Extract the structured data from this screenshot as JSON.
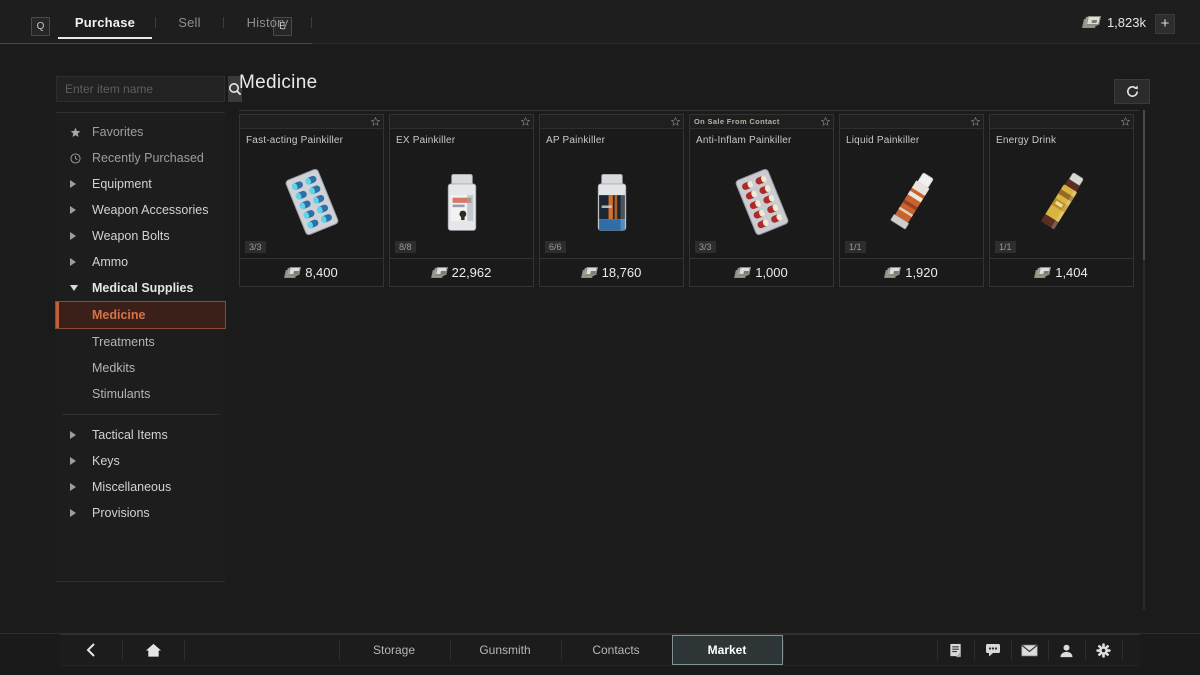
{
  "header": {
    "key_left": "Q",
    "key_right": "E",
    "tabs": [
      {
        "label": "Purchase",
        "active": true
      },
      {
        "label": "Sell",
        "active": false
      },
      {
        "label": "History",
        "active": false
      }
    ],
    "currency_amount": "1,823k",
    "currency_icon": "banknote-stack-icon",
    "add_label": "+"
  },
  "sidebar": {
    "search": {
      "value": "",
      "placeholder": "Enter item name",
      "icon": "search-icon"
    },
    "items": [
      {
        "label": "Favorites",
        "icon": "star-icon",
        "type": "link"
      },
      {
        "label": "Recently Purchased",
        "icon": "clock-icon",
        "type": "link"
      },
      {
        "label": "Equipment",
        "icon": "chevron-right-icon",
        "type": "group"
      },
      {
        "label": "Weapon Accessories",
        "icon": "chevron-right-icon",
        "type": "group"
      },
      {
        "label": "Weapon Bolts",
        "icon": "chevron-right-icon",
        "type": "group"
      },
      {
        "label": "Ammo",
        "icon": "chevron-right-icon",
        "type": "group"
      },
      {
        "label": "Medical Supplies",
        "icon": "chevron-down-icon",
        "type": "group-open"
      },
      {
        "label": "Medicine",
        "icon": "",
        "type": "sub-selected"
      },
      {
        "label": "Treatments",
        "icon": "",
        "type": "sub"
      },
      {
        "label": "Medkits",
        "icon": "",
        "type": "sub"
      },
      {
        "label": "Stimulants",
        "icon": "",
        "type": "sub"
      },
      {
        "label": "Tactical Items",
        "icon": "chevron-right-icon",
        "type": "group"
      },
      {
        "label": "Keys",
        "icon": "chevron-right-icon",
        "type": "group"
      },
      {
        "label": "Miscellaneous",
        "icon": "chevron-right-icon",
        "type": "group"
      },
      {
        "label": "Provisions",
        "icon": "chevron-right-icon",
        "type": "group"
      }
    ]
  },
  "main": {
    "title": "Medicine",
    "refresh_icon": "refresh-icon",
    "items": [
      {
        "banner": "",
        "name": "Fast-acting Painkiller",
        "stock": "3/3",
        "price": "8,400",
        "art": "pill-blister-blue"
      },
      {
        "banner": "",
        "name": "EX Painkiller",
        "stock": "8/8",
        "price": "22,962",
        "art": "pill-bottle-white"
      },
      {
        "banner": "",
        "name": "AP Painkiller",
        "stock": "6/6",
        "price": "18,760",
        "art": "pill-bottle-blue"
      },
      {
        "banner": "On Sale From Contact",
        "name": "Anti-Inflam Painkiller",
        "stock": "3/3",
        "price": "1,000",
        "art": "pill-blister-red"
      },
      {
        "banner": "",
        "name": "Liquid Painkiller",
        "stock": "1/1",
        "price": "1,920",
        "art": "tube-orange"
      },
      {
        "banner": "",
        "name": "Energy Drink",
        "stock": "1/1",
        "price": "1,404",
        "art": "bottle-yellow"
      }
    ]
  },
  "bottombar": {
    "back_icon": "back-arrow-icon",
    "home_icon": "home-icon",
    "tabs": [
      {
        "label": "Storage",
        "active": false
      },
      {
        "label": "Gunsmith",
        "active": false
      },
      {
        "label": "Contacts",
        "active": false
      },
      {
        "label": "Market",
        "active": true
      }
    ],
    "icons": [
      "notes-icon",
      "chat-icon",
      "mail-icon",
      "profile-icon",
      "settings-gear-icon"
    ]
  },
  "colors": {
    "accent": "#d4724a",
    "accent_border": "#8a4b33",
    "active_tab_border": "#7f9396",
    "background": "#1b1b1b"
  }
}
